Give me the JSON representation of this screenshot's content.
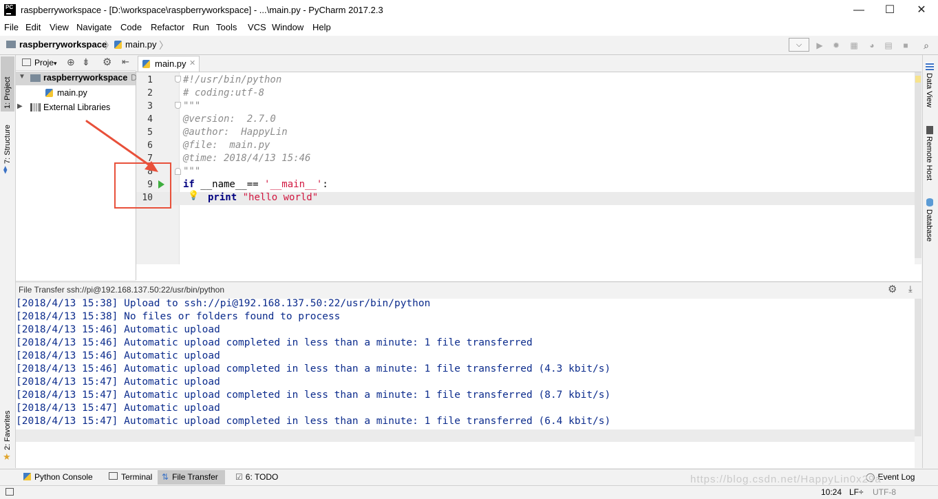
{
  "window": {
    "title": "raspberryworkspace - [D:\\workspace\\raspberryworkspace] - ...\\main.py - PyCharm 2017.2.3",
    "app_icon_text": "PC",
    "minimize": "—",
    "maximize": "☐",
    "close": "✕"
  },
  "menu": [
    "File",
    "Edit",
    "View",
    "Navigate",
    "Code",
    "Refactor",
    "Run",
    "Tools",
    "VCS",
    "Window",
    "Help"
  ],
  "breadcrumb": {
    "project": "raspberryworkspace",
    "file": "main.py"
  },
  "left_stripe": {
    "project_tab": "1: Project",
    "structure_tab": "7: Structure",
    "favorites_tab": "2: Favorites"
  },
  "right_stripe": {
    "data_view": "Data View",
    "remote_host": "Remote Host",
    "database": "Database"
  },
  "project_panel": {
    "selector_label": "Proje",
    "root": "raspberryworkspace",
    "root_suffix": "D",
    "file": "main.py",
    "external": "External Libraries"
  },
  "editor": {
    "tab_label": "main.py",
    "line_numbers": [
      "1",
      "2",
      "3",
      "4",
      "5",
      "6",
      "7",
      "8",
      "9",
      "10"
    ],
    "lines": {
      "l1": "#!/usr/bin/python",
      "l2": "# coding:utf-8",
      "l3": "\"\"\"",
      "l4": "@version:  2.7.0",
      "l5": "@author:  HappyLin",
      "l6": "@file:  main.py",
      "l7": "@time: 2018/4/13 15:46",
      "l8": "\"\"\"",
      "l9_kw": "if",
      "l9_mid": " __name__== ",
      "l9_str": "'__main__'",
      "l9_end": ":",
      "l10_kw": "print",
      "l10_str": "\"hello world\""
    }
  },
  "file_transfer": {
    "header": "File Transfer ssh://pi@192.168.137.50:22/usr/bin/python",
    "log": [
      "[2018/4/13 15:38] Upload to ssh://pi@192.168.137.50:22/usr/bin/python",
      "[2018/4/13 15:38] No files or folders found to process",
      "[2018/4/13 15:46] Automatic upload",
      "[2018/4/13 15:46] Automatic upload completed in less than a minute: 1 file transferred",
      "[2018/4/13 15:46] Automatic upload",
      "[2018/4/13 15:46] Automatic upload completed in less than a minute: 1 file transferred (4.3 kbit/s)",
      "[2018/4/13 15:47] Automatic upload",
      "[2018/4/13 15:47] Automatic upload completed in less than a minute: 1 file transferred (8.7 kbit/s)",
      "[2018/4/13 15:47] Automatic upload",
      "[2018/4/13 15:47] Automatic upload completed in less than a minute: 1 file transferred (6.4 kbit/s)"
    ]
  },
  "bottom_tabs": {
    "python_console": "Python Console",
    "terminal": "Terminal",
    "file_transfer": "File Transfer",
    "todo": "6: TODO",
    "event_log": "Event Log"
  },
  "status": {
    "time": "10:24",
    "line_sep": "LF÷",
    "encoding": "UTF-8"
  },
  "watermark": "https://blog.csdn.net/HappyLin0x29a",
  "colors": {
    "annotation": "#e8503a",
    "log_text": "#0b2b8c",
    "run_arrow": "#3fae3f"
  }
}
